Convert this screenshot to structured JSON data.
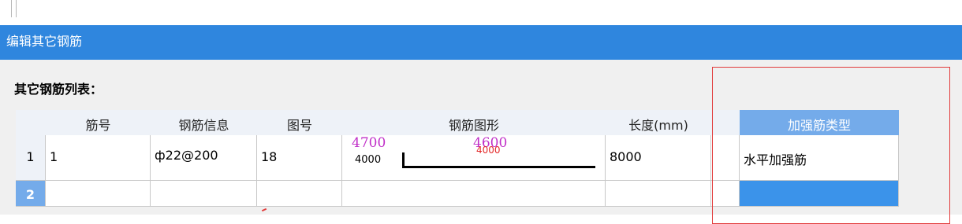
{
  "dialog": {
    "title": "编辑其它钢筋",
    "list_label": "其它钢筋列表："
  },
  "table": {
    "columns": [
      "筋号",
      "钢筋信息",
      "图号",
      "钢筋图形",
      "长度(mm)",
      "加强筋类型"
    ],
    "rows": [
      {
        "index": "1",
        "bar_no": "1",
        "bar_info": "ф22@200",
        "figure_no": "18",
        "shape": {
          "top_left": "4700",
          "top_right": "4600",
          "left_dim": "4000",
          "mid_dim": "4000"
        },
        "length": "8000",
        "type": "水平加强筋"
      },
      {
        "index": "2",
        "bar_no": "",
        "bar_info": "",
        "figure_no": "",
        "shape": {},
        "length": "",
        "type": ""
      }
    ]
  },
  "colors": {
    "titlebar": "#2f86de",
    "selected_header": "#74abea",
    "highlight_box": "#e23b3b"
  }
}
